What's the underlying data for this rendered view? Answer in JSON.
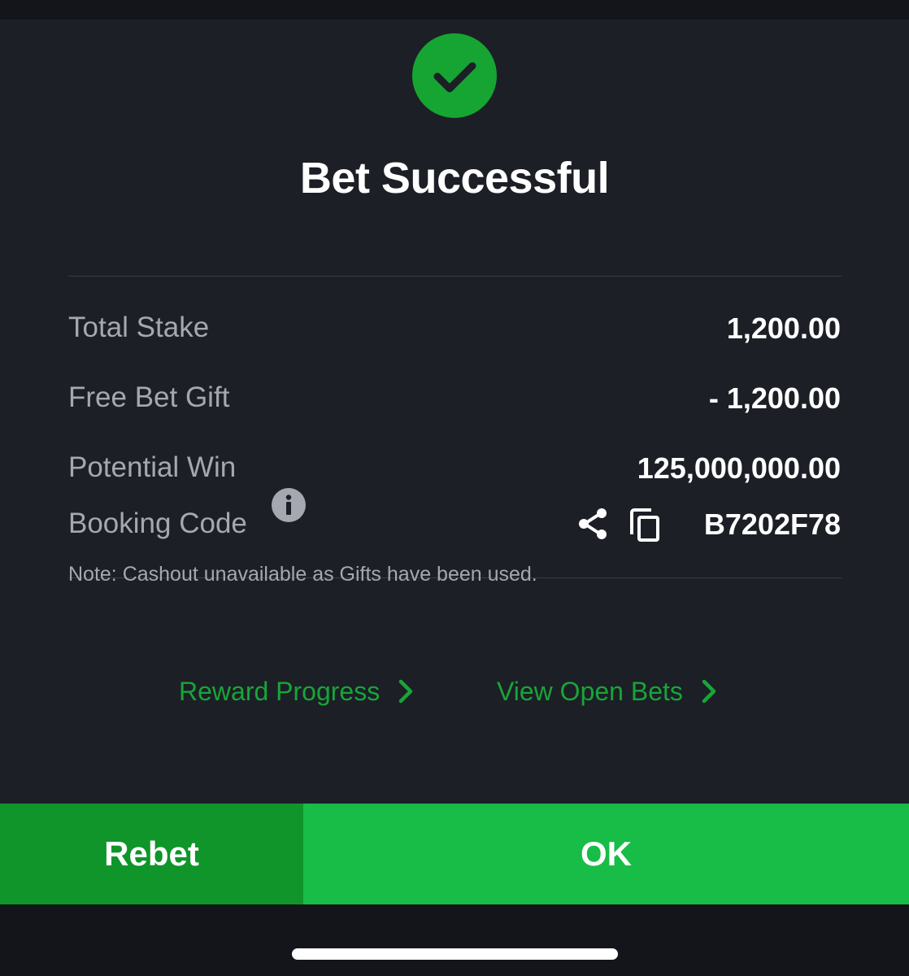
{
  "title": "Bet Successful",
  "rows": [
    {
      "label": "Total Stake",
      "value": "1,200.00"
    },
    {
      "label": "Free Bet Gift",
      "value": "- 1,200.00"
    },
    {
      "label": "Potential Win",
      "value": "125,000,000.00"
    }
  ],
  "booking": {
    "label": "Booking Code",
    "code": "B7202F78"
  },
  "note": "Note: Cashout unavailable as Gifts have been used.",
  "links": {
    "reward_progress": "Reward Progress",
    "view_open_bets": "View Open Bets"
  },
  "buttons": {
    "rebet": "Rebet",
    "ok": "OK"
  },
  "colors": {
    "accent_green": "#16a533",
    "ok_button": "#17bd46",
    "rebet_button": "#0f952a",
    "link_green": "#17a538",
    "modal_background": "#1c1f26"
  },
  "icons": [
    "checkmark-icon",
    "info-icon",
    "share-icon",
    "copy-icon",
    "chevron-right-icon"
  ]
}
